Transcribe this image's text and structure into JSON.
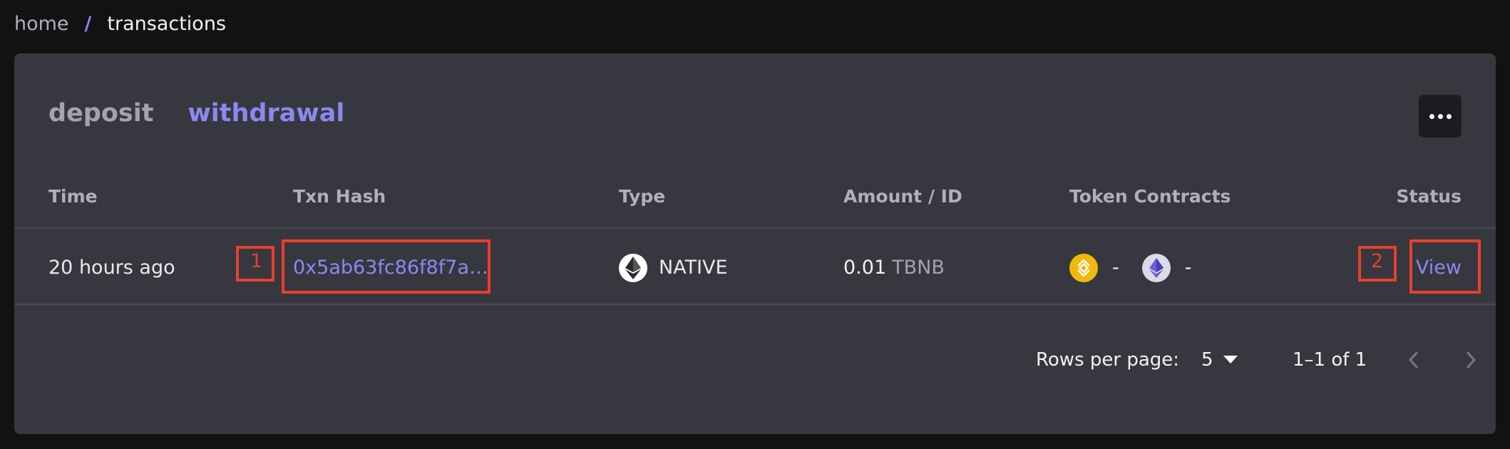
{
  "breadcrumb": {
    "home": "home",
    "separator": "/",
    "current": "transactions"
  },
  "tabs": [
    {
      "label": "deposit",
      "active": false
    },
    {
      "label": "withdrawal",
      "active": true
    }
  ],
  "table": {
    "headers": {
      "time": "Time",
      "txn_hash": "Txn Hash",
      "type": "Type",
      "amount": "Amount / ID",
      "token_contracts": "Token Contracts",
      "status": "Status"
    },
    "rows": [
      {
        "time": "20 hours ago",
        "txn_hash": "0x5ab63fc86f8f7a…",
        "type": "NATIVE",
        "type_icon": "ethereum-icon",
        "amount_value": "0.01",
        "amount_unit": "TBNB",
        "token_contract_1": "-",
        "token_contract_1_icon": "bnb-chain-icon",
        "token_contract_2": "-",
        "token_contract_2_icon": "ethereum-icon",
        "status": "View"
      }
    ]
  },
  "markers": {
    "m1": "1",
    "m2": "2"
  },
  "pagination": {
    "rows_per_page_label": "Rows per page:",
    "rows_per_page_value": "5",
    "range": "1–1 of 1"
  },
  "colors": {
    "accent": "#8b88f0",
    "card": "#37373f",
    "background": "#121213",
    "marker": "#e8402c"
  }
}
